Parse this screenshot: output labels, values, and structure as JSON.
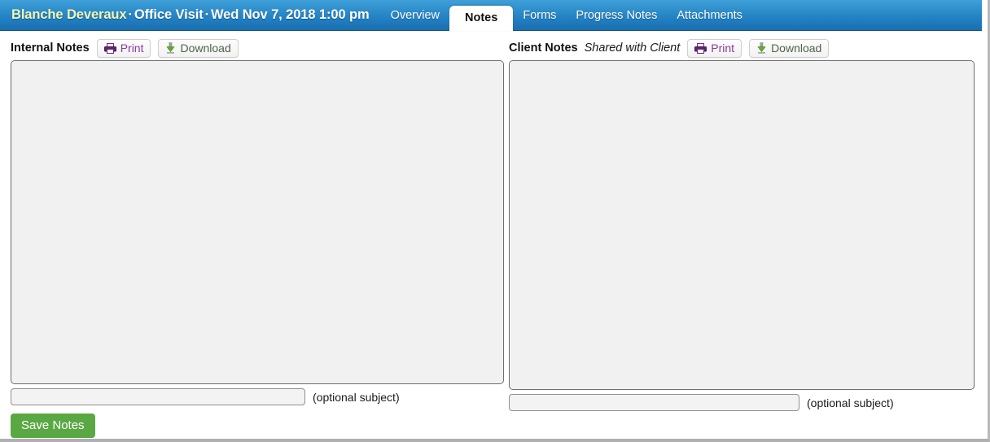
{
  "header": {
    "client_name": "Blanche Deveraux",
    "separator": "·",
    "appointment_type": "Office Visit",
    "appointment_datetime": "Wed Nov 7, 2018 1:00 pm",
    "accent_color": "#2e8ecb",
    "client_name_color": "#f3f7b8",
    "tabs": [
      {
        "label": "Overview",
        "active": false
      },
      {
        "label": "Notes",
        "active": true
      },
      {
        "label": "Forms",
        "active": false
      },
      {
        "label": "Progress Notes",
        "active": false
      },
      {
        "label": "Attachments",
        "active": false
      }
    ]
  },
  "internal_notes": {
    "title": "Internal Notes",
    "print_label": "Print",
    "print_icon": "printer-icon",
    "print_color": "#8a3a9e",
    "download_label": "Download",
    "download_icon": "download-arrow-icon",
    "download_color": "#4e6446",
    "notes_value": "",
    "notes_placeholder": "",
    "subject_value": "",
    "subject_placeholder": "",
    "subject_hint": "(optional subject)"
  },
  "client_notes": {
    "title": "Client Notes",
    "shared_label": "Shared with Client",
    "print_label": "Print",
    "print_icon": "printer-icon",
    "download_label": "Download",
    "download_icon": "download-arrow-icon",
    "notes_value": "",
    "notes_placeholder": "",
    "subject_value": "",
    "subject_placeholder": "",
    "subject_hint": "(optional subject)"
  },
  "actions": {
    "save_label": "Save Notes",
    "save_color": "#5aa844"
  }
}
